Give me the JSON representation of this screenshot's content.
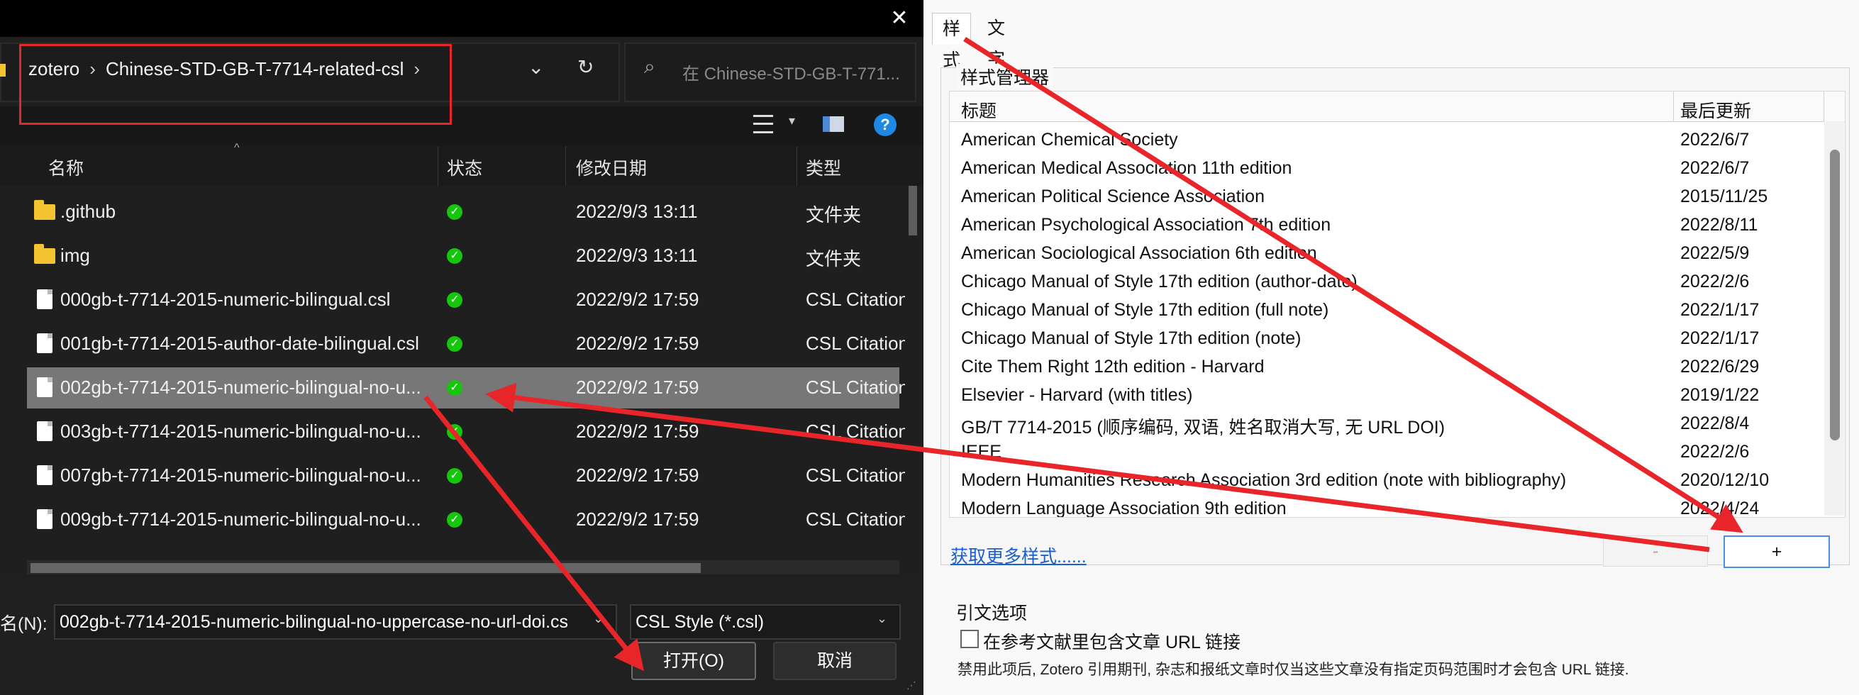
{
  "file_dialog": {
    "breadcrumb": [
      "zotero",
      "Chinese-STD-GB-T-7714-related-csl"
    ],
    "search_placeholder": "在 Chinese-STD-GB-T-771...",
    "columns": {
      "name": "名称",
      "status": "状态",
      "modified": "修改日期",
      "type": "类型"
    },
    "rows": [
      {
        "name": ".github",
        "date": "2022/9/3 13:11",
        "type": "文件夹",
        "kind": "folder",
        "selected": false
      },
      {
        "name": "img",
        "date": "2022/9/3 13:11",
        "type": "文件夹",
        "kind": "folder",
        "selected": false
      },
      {
        "name": "000gb-t-7714-2015-numeric-bilingual.csl",
        "date": "2022/9/2 17:59",
        "type": "CSL Citation",
        "kind": "file",
        "selected": false
      },
      {
        "name": "001gb-t-7714-2015-author-date-bilingual.csl",
        "date": "2022/9/2 17:59",
        "type": "CSL Citation",
        "kind": "file",
        "selected": false
      },
      {
        "name": "002gb-t-7714-2015-numeric-bilingual-no-u...",
        "date": "2022/9/2 17:59",
        "type": "CSL Citation",
        "kind": "file",
        "selected": true
      },
      {
        "name": "003gb-t-7714-2015-numeric-bilingual-no-u...",
        "date": "2022/9/2 17:59",
        "type": "CSL Citation",
        "kind": "file",
        "selected": false
      },
      {
        "name": "007gb-t-7714-2015-numeric-bilingual-no-u...",
        "date": "2022/9/2 17:59",
        "type": "CSL Citation",
        "kind": "file",
        "selected": false
      },
      {
        "name": "009gb-t-7714-2015-numeric-bilingual-no-u...",
        "date": "2022/9/2 17:59",
        "type": "CSL Citation",
        "kind": "file",
        "selected": false
      }
    ],
    "filename_label": "名(N):",
    "filename_value": "002gb-t-7714-2015-numeric-bilingual-no-uppercase-no-url-doi.cs",
    "filetype_value": "CSL Style (*.csl)",
    "open_label": "打开(O)",
    "cancel_label": "取消",
    "status_color": "#16c60c"
  },
  "zotero": {
    "tabs": [
      "样式",
      "文字处理软件"
    ],
    "style_manager_title": "样式管理器",
    "columns": {
      "title": "标题",
      "updated": "最后更新"
    },
    "styles": [
      {
        "title": "American Chemical Society",
        "updated": "2022/6/7"
      },
      {
        "title": "American Medical Association 11th edition",
        "updated": "2022/6/7"
      },
      {
        "title": "American Political Science Association",
        "updated": "2015/11/25"
      },
      {
        "title": "American Psychological Association 7th edition",
        "updated": "2022/8/11"
      },
      {
        "title": "American Sociological Association 6th edition",
        "updated": "2022/5/9"
      },
      {
        "title": "Chicago Manual of Style 17th edition (author-date)",
        "updated": "2022/2/6"
      },
      {
        "title": "Chicago Manual of Style 17th edition (full note)",
        "updated": "2022/1/17"
      },
      {
        "title": "Chicago Manual of Style 17th edition (note)",
        "updated": "2022/1/17"
      },
      {
        "title": "Cite Them Right 12th edition - Harvard",
        "updated": "2022/6/29"
      },
      {
        "title": "Elsevier - Harvard (with titles)",
        "updated": "2019/1/22"
      },
      {
        "title": "GB/T 7714-2015 (顺序编码, 双语, 姓名取消大写, 无 URL DOI)",
        "updated": "2022/8/4"
      },
      {
        "title": "IEEE",
        "updated": "2022/2/6"
      },
      {
        "title": "Modern Humanities Research Association 3rd edition (note with bibliography)",
        "updated": "2020/12/10"
      },
      {
        "title": "Modern Language Association 9th edition",
        "updated": "2022/4/24"
      }
    ],
    "more_styles_link": "获取更多样式......",
    "minus_label": "-",
    "plus_label": "+",
    "citation_options_title": "引文选项",
    "include_url_label": "在参考文献里包含文章 URL 链接",
    "include_url_note": "禁用此项后, Zotero 引用期刊, 杂志和报纸文章时仅当这些文章没有指定页码范围时才会包含 URL 链接."
  },
  "annotation_color": "#e8262a"
}
